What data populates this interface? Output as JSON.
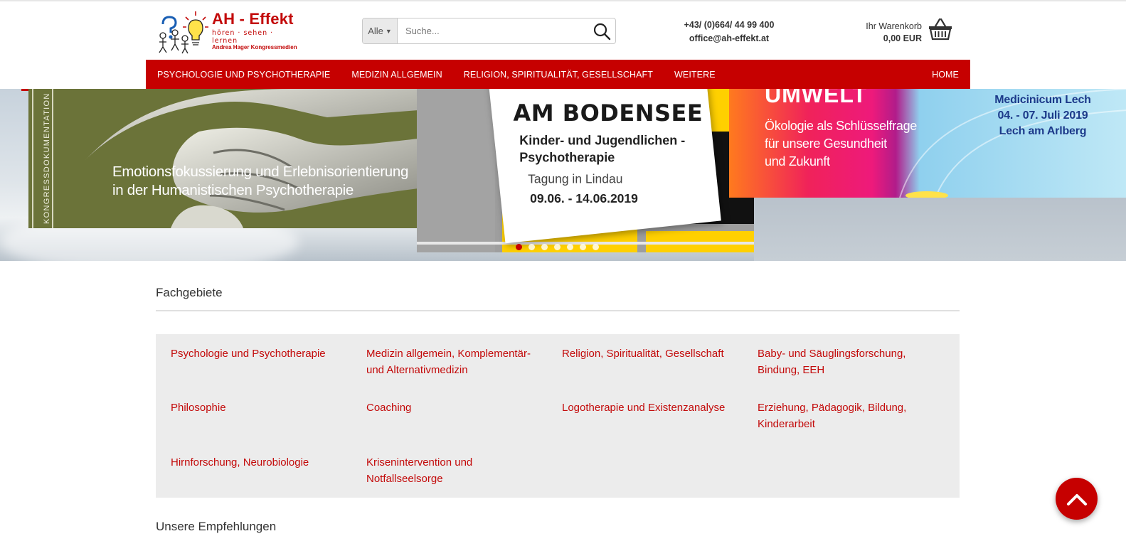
{
  "header": {
    "logo_title": "AH - Effekt",
    "logo_tagline": "hören · sehen · lernen",
    "logo_subline": "Andrea Hager Kongressmedien",
    "search": {
      "category": "Alle",
      "placeholder": "Suche..."
    },
    "contact": {
      "phone": "+43/ (0)664/ 44 99 400",
      "email": "office@ah-effekt.at"
    },
    "cart": {
      "label": "Ihr Warenkorb",
      "total": "0,00 EUR"
    }
  },
  "nav": {
    "items": [
      "PSYCHOLOGIE UND PSYCHOTHERAPIE",
      "MEDIZIN ALLGEMEIN",
      "RELIGION, SPIRITUALITÄT, GESELLSCHAFT",
      "WEITERE"
    ],
    "home": "HOME"
  },
  "slider": {
    "slide1": {
      "vertical_label": "KONGRESSDOKUMENTATION",
      "caption_line1": "Emotionsfokussierung und Erlebnisorientierung",
      "caption_line2": "in der Humanistischen Psychotherapie"
    },
    "slide2": {
      "title": "AM BODENSEE",
      "subtitle_line1": "Kinder- und Jugendlichen -",
      "subtitle_line2": "Psychotherapie",
      "place": "Tagung in Lindau",
      "dates": "09.06. - 14.06.2019"
    },
    "slide3": {
      "heading": "UMWELT",
      "text_line1": "Ökologie als Schlüsselfrage",
      "text_line2": "für unsere Gesundheit",
      "text_line3": "und Zukunft",
      "event_line1": "Medicinicum Lech",
      "event_line2": "04. - 07. Juli 2019",
      "event_line3": "Lech am Arlberg"
    },
    "dots_count": 7,
    "active_dot": 1,
    "accent_color": "#c60000"
  },
  "fachgebiete": {
    "title": "Fachgebiete",
    "categories": [
      "Psychologie und Psychotherapie",
      "Medizin allgemein, Komplementär- und Alternativmedizin",
      "Religion, Spiritualität, Gesellschaft",
      "Baby- und Säuglingsforschung, Bindung, EEH",
      "Philosophie",
      "Coaching",
      "Logotherapie und Existenzanalyse",
      "Erziehung, Pädagogik, Bildung, Kinderarbeit",
      "Hirnforschung, Neurobiologie",
      "Krisenintervention und Notfallseelsorge"
    ]
  },
  "empfehlungen": {
    "title": "Unsere Empfehlungen"
  },
  "icons": {
    "search": "search-icon",
    "cart": "basket-icon",
    "scroll_top": "chevron-up-icon"
  },
  "colors": {
    "brand_red": "#c60000",
    "link_red": "#c30a0a",
    "panel_grey": "#ececec"
  }
}
